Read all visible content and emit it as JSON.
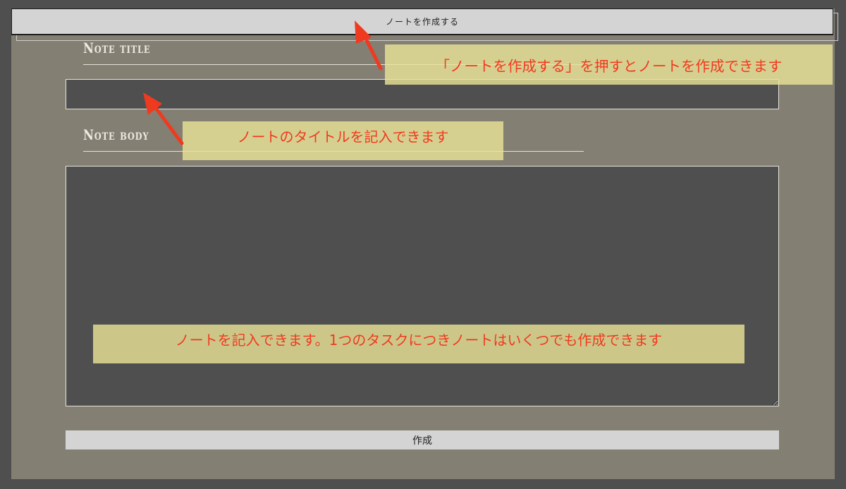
{
  "form": {
    "create_note_button": "ノートを作成する",
    "title_label": "Note title",
    "body_label": "Note body",
    "title_value": "",
    "body_value": "",
    "submit_button": "作成"
  },
  "annotations": {
    "create_note": "「ノートを作成する」を押すとノートを作成できます",
    "title_field": "ノートのタイトルを記入できます",
    "body_field": "ノートを記入できます。1つのタスクにつきノートはいくつでも作成できます"
  },
  "colors": {
    "page_background": "#4f4f4f",
    "panel_background": "#837f73",
    "button_background": "#d4d4d4",
    "annotation_background": "#e8e296",
    "annotation_text": "#f03a1f",
    "arrow": "#f03a1f"
  }
}
